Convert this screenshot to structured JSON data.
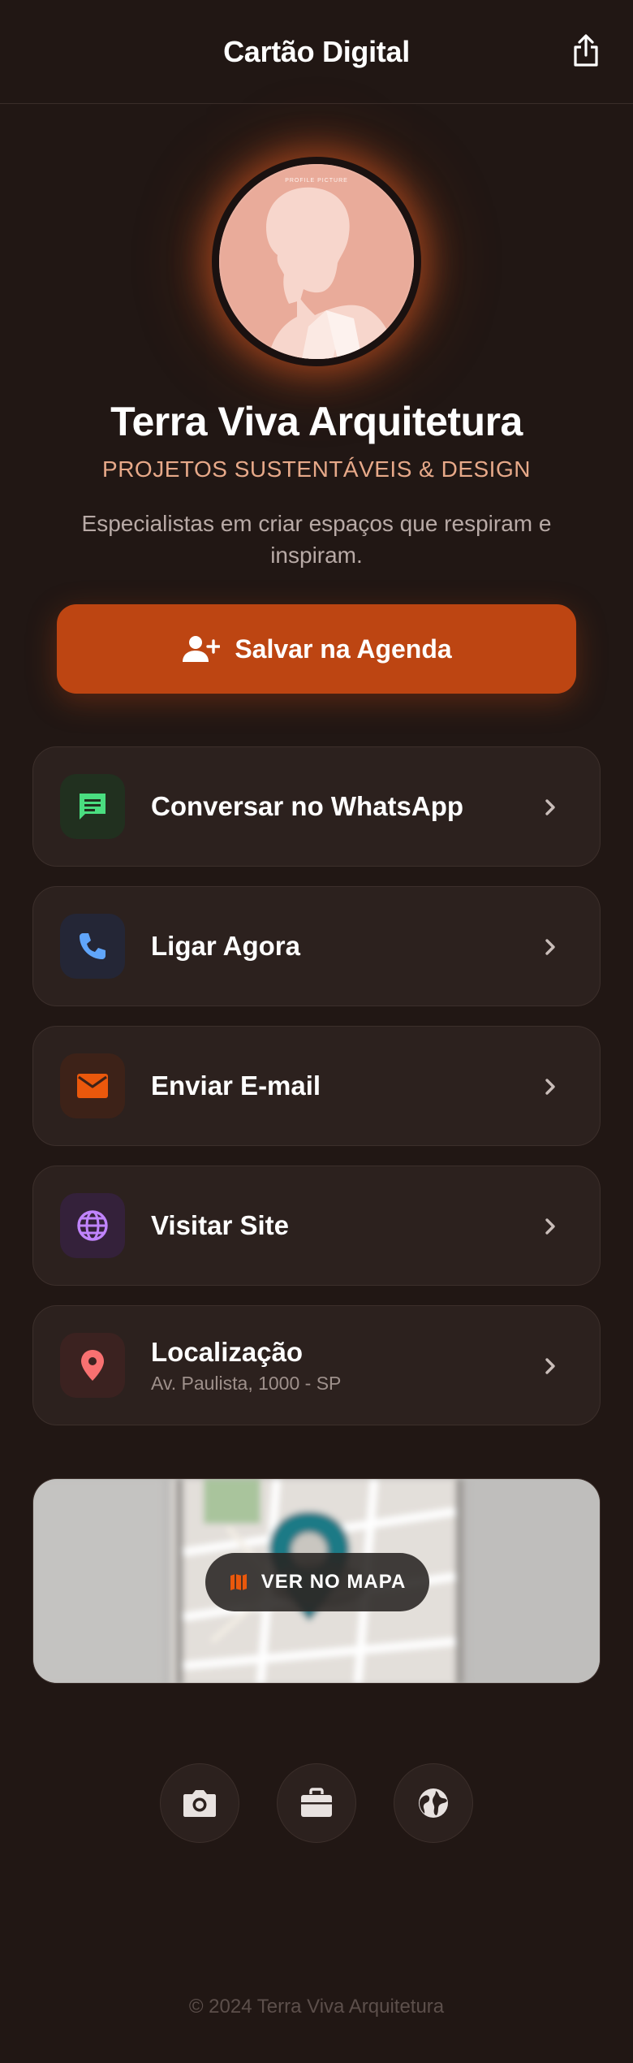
{
  "header": {
    "title": "Cartão Digital",
    "share_icon": "share-icon"
  },
  "profile": {
    "avatar_caption": "PROFILE PICTURE",
    "name": "Terra Viva Arquitetura",
    "tagline": "PROJETOS SUSTENTÁVEIS & DESIGN",
    "description": "Especialistas em criar espaços que respiram e inspiram."
  },
  "save_button": {
    "label": "Salvar na Agenda",
    "icon": "person-add-icon"
  },
  "actions": [
    {
      "label": "Conversar no WhatsApp",
      "icon": "chat-icon",
      "icon_color": "#4ade80",
      "icon_bg": "#21301f"
    },
    {
      "label": "Ligar Agora",
      "icon": "phone-icon",
      "icon_color": "#60a5fa",
      "icon_bg": "#242636"
    },
    {
      "label": "Enviar E-mail",
      "icon": "mail-icon",
      "icon_color": "#ea580c",
      "icon_bg": "#3d2218"
    },
    {
      "label": "Visitar Site",
      "icon": "globe-icon",
      "icon_color": "#c084fc",
      "icon_bg": "#34213a"
    },
    {
      "label": "Localização",
      "sublabel": "Av. Paulista, 1000 - SP",
      "icon": "location-pin-icon",
      "icon_color": "#f87171",
      "icon_bg": "#3b2220"
    }
  ],
  "map": {
    "button_label": "VER NO MAPA",
    "icon": "map-icon"
  },
  "social": [
    {
      "icon": "camera-icon"
    },
    {
      "icon": "briefcase-icon"
    },
    {
      "icon": "globe-icon"
    }
  ],
  "footer": {
    "text": "© 2024 Terra Viva Arquitetura"
  },
  "colors": {
    "background": "#211714",
    "card": "#2c211e",
    "accent": "#bd4512",
    "tagline": "#e7a989"
  }
}
